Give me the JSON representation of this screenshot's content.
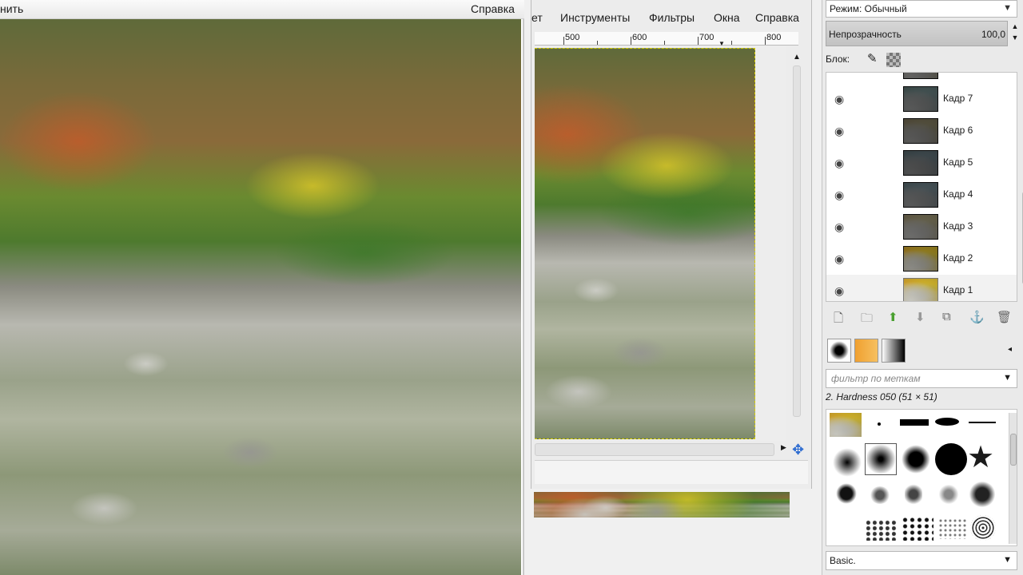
{
  "left_window": {
    "menu_left": "нить",
    "menu_right": "Справка"
  },
  "image_window": {
    "menu": [
      "ет",
      "Инструменты",
      "Фильтры",
      "Окна",
      "Справка"
    ],
    "ruler_labels": [
      "500",
      "600",
      "700",
      "800"
    ]
  },
  "layers_dock": {
    "mode_label": "Режим: Обычный",
    "opacity_label": "Непрозрачность",
    "opacity_value": "100,0",
    "lock_label": "Блок:",
    "layers": [
      {
        "name": "Кадр 7"
      },
      {
        "name": "Кадр 6"
      },
      {
        "name": "Кадр 5"
      },
      {
        "name": "Кадр 4"
      },
      {
        "name": "Кадр 3"
      },
      {
        "name": "Кадр 2"
      },
      {
        "name": "Кадр 1"
      }
    ],
    "actions": [
      "new-layer-icon",
      "new-group-icon",
      "raise-layer-icon",
      "lower-layer-icon",
      "duplicate-layer-icon",
      "anchor-layer-icon",
      "delete-layer-icon"
    ]
  },
  "brushes_dock": {
    "filter_placeholder": "фильтр по меткам",
    "selected_brush": "2. Hardness 050 (51 × 51)",
    "preset": "Basic."
  },
  "colors": {
    "accent": "#2a6ad0",
    "selection": "#d8d000"
  }
}
